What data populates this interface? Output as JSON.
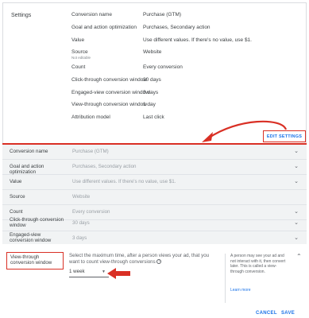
{
  "settings": {
    "title": "Settings",
    "rows": [
      {
        "key": "Conversion name",
        "sub": "",
        "value": "Purchase (GTM)"
      },
      {
        "key": "Goal and action optimization",
        "sub": "",
        "value": "Purchases, Secondary action"
      },
      {
        "key": "Value",
        "sub": "",
        "value": "Use different values. If there's no value, use $1."
      },
      {
        "key": "Source",
        "sub": "Not editable",
        "value": "Website"
      },
      {
        "key": "Count",
        "sub": "",
        "value": "Every conversion"
      },
      {
        "key": "Click-through conversion window",
        "sub": "",
        "value": "30 days"
      },
      {
        "key": "Engaged-view conversion window",
        "sub": "",
        "value": "3 days"
      },
      {
        "key": "View-through conversion window",
        "sub": "",
        "value": "1 day"
      },
      {
        "key": "Attribution model",
        "sub": "",
        "value": "Last click"
      }
    ],
    "edit_button": "EDIT SETTINGS"
  },
  "edit": {
    "rows": [
      {
        "label": "Conversion name",
        "value": "Purchase (GTM)"
      },
      {
        "label": "Goal and action optimization",
        "value": "Purchases, Secondary action"
      },
      {
        "label": "Value",
        "value": "Use different values. If there's no value, use $1."
      },
      {
        "label": "Source",
        "value": "Website"
      },
      {
        "label": "Count",
        "value": "Every conversion"
      },
      {
        "label": "Click-through conversion window",
        "value": "30 days"
      },
      {
        "label": "Engaged-view conversion window",
        "value": "3 days"
      }
    ]
  },
  "view_through": {
    "label": "View-through conversion window",
    "description": "Select the maximum time, after a person views your ad, that you want to count view-through conversions",
    "selected": "1 week",
    "tip": "A person may see your ad and not interact with it, then convert later. This is called a view-through conversion.",
    "learn_more": "Learn more"
  },
  "footer": {
    "cancel": "CANCEL",
    "save": "SAVE"
  },
  "colors": {
    "accent": "#1a73e8",
    "highlight": "#d93025",
    "edit_bg": "#f1f3f4"
  }
}
